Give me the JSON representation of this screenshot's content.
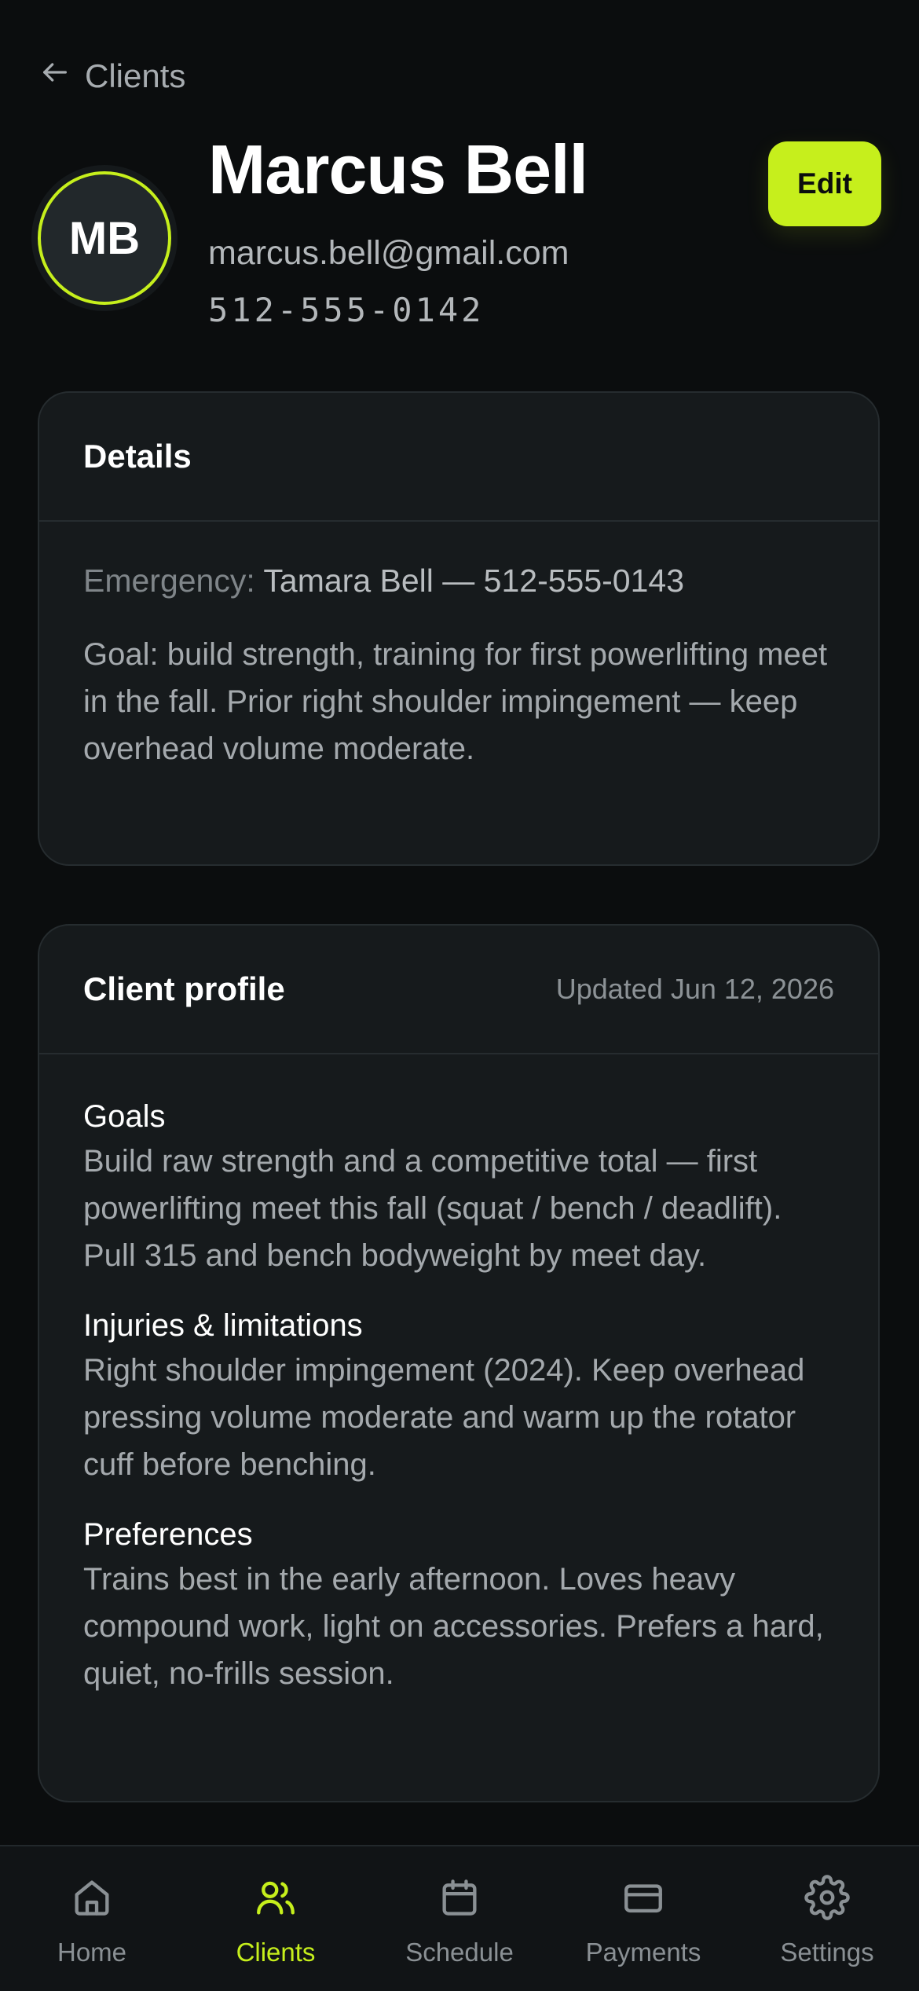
{
  "header": {
    "back_label": "Clients",
    "avatar_initials": "MB",
    "name": "Marcus Bell",
    "email": "marcus.bell@gmail.com",
    "phone": "512-555-0142",
    "edit_label": "Edit"
  },
  "details": {
    "title": "Details",
    "emergency_label": "Emergency:",
    "emergency_value": "Tamara Bell — 512-555-0143",
    "note": "Goal: build strength, training for first powerlifting meet in the fall. Prior right shoulder impingement — keep overhead volume moderate."
  },
  "profile": {
    "title": "Client profile",
    "updated": "Updated Jun 12, 2026",
    "sections": [
      {
        "title": "Goals",
        "text": "Build raw strength and a competitive total — first powerlifting meet this fall (squat / bench / deadlift). Pull 315 and bench bodyweight by meet day."
      },
      {
        "title": "Injuries & limitations",
        "text": "Right shoulder impingement (2024). Keep overhead pressing volume moderate and warm up the rotator cuff before benching."
      },
      {
        "title": "Preferences",
        "text": "Trains best in the early afternoon. Loves heavy compound work, light on accessories. Prefers a hard, quiet, no-frills session."
      }
    ]
  },
  "tabs": [
    {
      "label": "Home",
      "icon": "home-icon"
    },
    {
      "label": "Clients",
      "icon": "users-icon"
    },
    {
      "label": "Schedule",
      "icon": "calendar-icon"
    },
    {
      "label": "Payments",
      "icon": "credit-card-icon"
    },
    {
      "label": "Settings",
      "icon": "gear-icon"
    }
  ],
  "active_tab": "Clients",
  "colors": {
    "accent": "#c6ef1c",
    "background": "#0b0d0e",
    "card": "#161a1c"
  }
}
